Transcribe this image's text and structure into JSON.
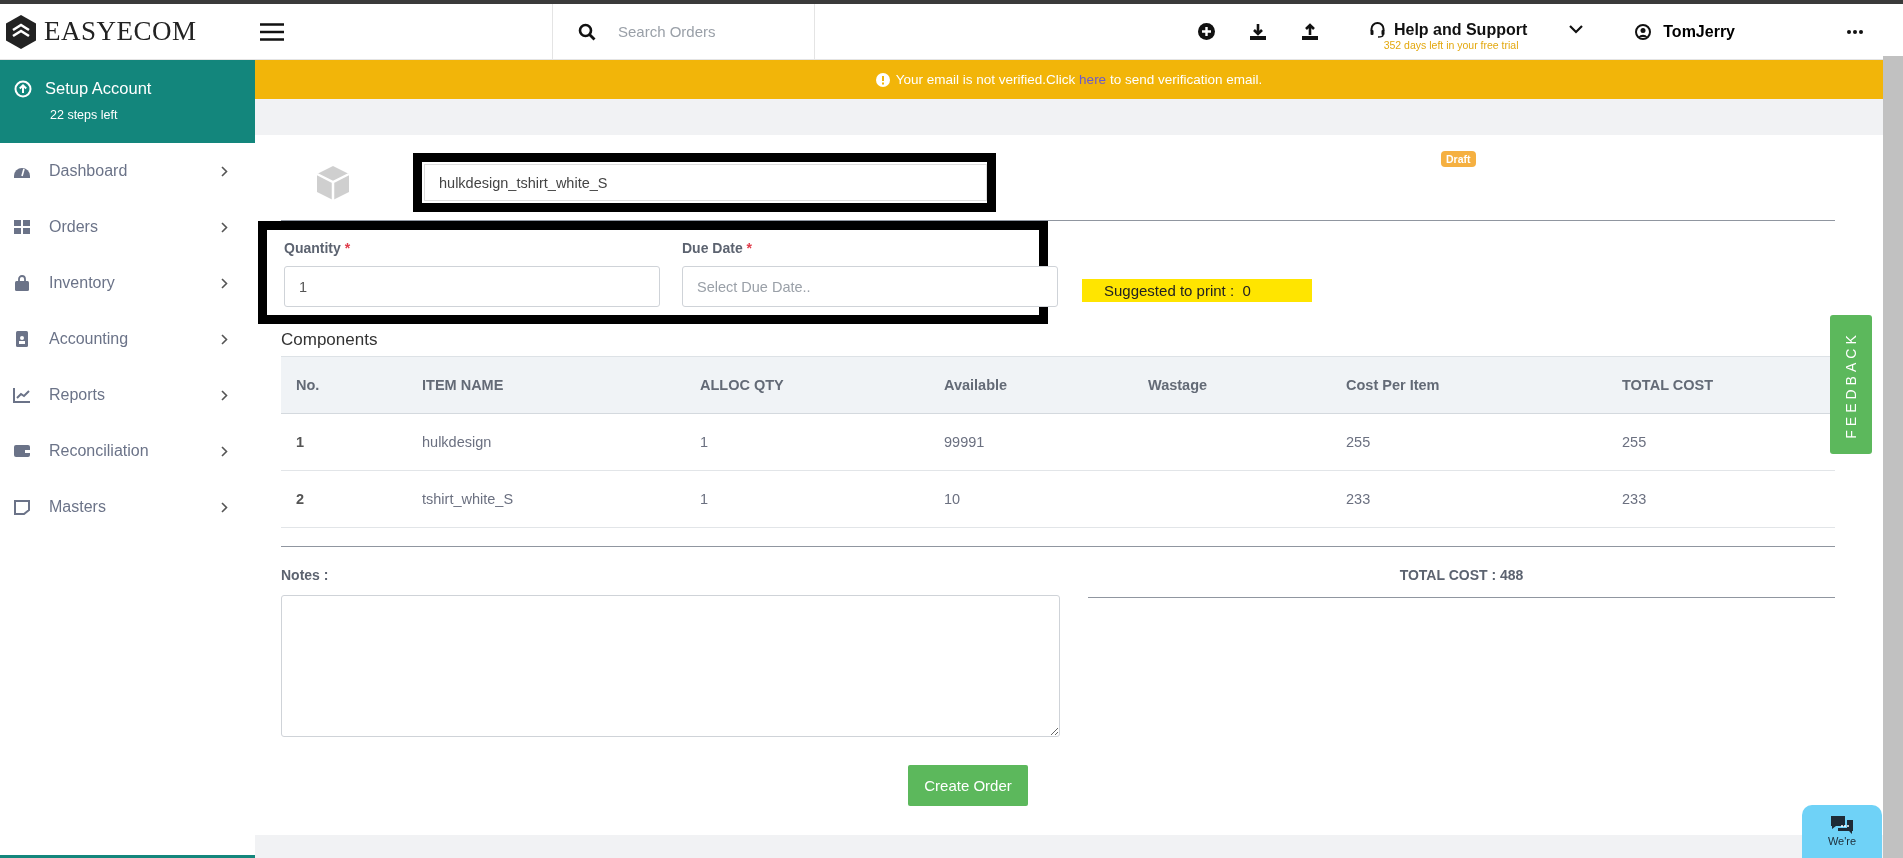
{
  "brand": {
    "name": "EASYECOM"
  },
  "search": {
    "placeholder": "Search Orders"
  },
  "help": {
    "label": "Help and Support",
    "trial": "352 days left in your free trial"
  },
  "user": {
    "name": "TomJerry"
  },
  "banner": {
    "before": "Your email is not verified.Click ",
    "link": "here",
    "after": " to send verification email."
  },
  "setup": {
    "title": "Setup Account",
    "subtitle": "22 steps left"
  },
  "sidebar": {
    "items": [
      {
        "label": "Dashboard"
      },
      {
        "label": "Orders"
      },
      {
        "label": "Inventory"
      },
      {
        "label": "Accounting"
      },
      {
        "label": "Reports"
      },
      {
        "label": "Reconciliation"
      },
      {
        "label": "Masters"
      }
    ]
  },
  "product": {
    "value": "hulkdesign_tshirt_white_S",
    "status": "Draft"
  },
  "fields": [
    {
      "label": "Quantity",
      "required_mark": "*",
      "value": "1"
    },
    {
      "label": "Due Date",
      "required_mark": "*",
      "placeholder": "Select Due Date.."
    }
  ],
  "suggested": "Suggested to print :  0",
  "components": {
    "title": "Components",
    "columns": [
      "No.",
      "ITEM NAME",
      "ALLOC QTY",
      "Available",
      "Wastage",
      "Cost Per Item",
      "TOTAL COST"
    ],
    "rows": [
      [
        "1",
        "hulkdesign",
        "1",
        "99991",
        "",
        "255",
        "255"
      ],
      [
        "2",
        "tshirt_white_S",
        "1",
        "10",
        "",
        "233",
        "233"
      ]
    ]
  },
  "notes": {
    "label": "Notes :"
  },
  "total": "TOTAL COST : 488",
  "create_button": "Create Order",
  "feedback": "FEEDBACK",
  "chat": {
    "label": "We're"
  }
}
